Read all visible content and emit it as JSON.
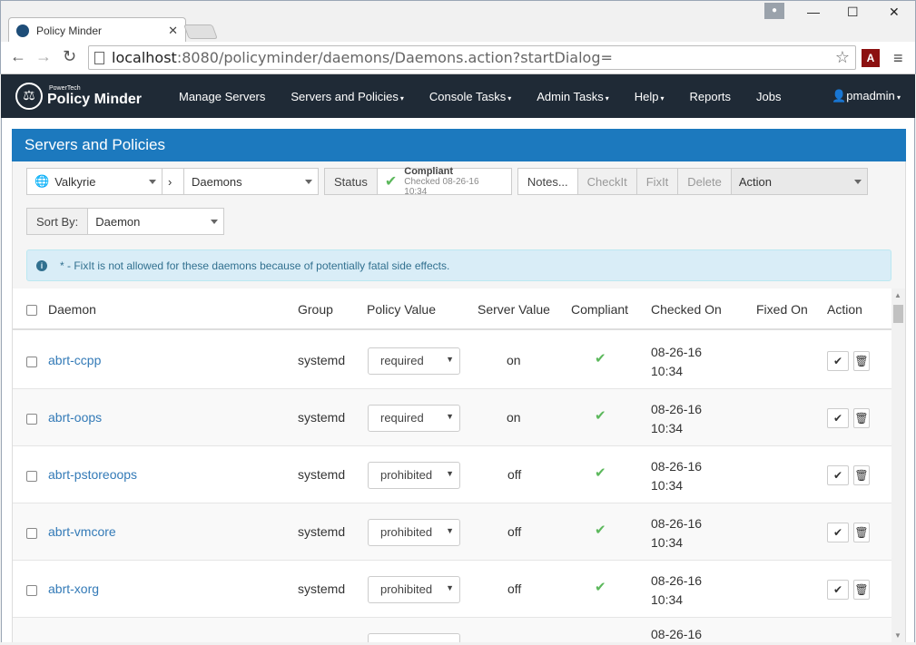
{
  "browser": {
    "tab_title": "Policy Minder",
    "tab_close": "✕",
    "url_host": "localhost",
    "url_path": ":8080/policyminder/daemons/Daemons.action?startDialog=",
    "pdf_label": "A",
    "win_minimize": "—",
    "win_maximize": "☐",
    "win_close": "✕"
  },
  "nav": {
    "brand_small": "PowerTech",
    "brand_big": "Policy Minder",
    "items": [
      {
        "label": "Manage Servers",
        "caret": ""
      },
      {
        "label": "Servers and Policies",
        "caret": "▾"
      },
      {
        "label": "Console Tasks",
        "caret": "▾"
      },
      {
        "label": "Admin Tasks",
        "caret": "▾"
      },
      {
        "label": "Help",
        "caret": "▾"
      },
      {
        "label": "Reports",
        "caret": ""
      },
      {
        "label": "Jobs",
        "caret": ""
      }
    ],
    "user": "pmadmin"
  },
  "panel": {
    "title": "Servers and Policies"
  },
  "toolbar": {
    "server": "Valkyrie",
    "policy": "Daemons",
    "status_label": "Status",
    "status_value": "Compliant",
    "status_checked": "Checked 08-26-16 10:34",
    "notes": "Notes...",
    "checkit": "CheckIt",
    "fixit": "FixIt",
    "delete": "Delete",
    "action": "Action",
    "sort_label": "Sort By:",
    "sort_value": "Daemon"
  },
  "alert": {
    "text": "* - FixIt is not allowed for these daemons because of potentially fatal side effects."
  },
  "table": {
    "headers": {
      "daemon": "Daemon",
      "group": "Group",
      "policy_value": "Policy Value",
      "server_value": "Server Value",
      "compliant": "Compliant",
      "checked_on": "Checked On",
      "fixed_on": "Fixed On",
      "action": "Action"
    },
    "rows": [
      {
        "daemon": "abrt-ccpp",
        "group": "systemd",
        "policy": "required",
        "server": "on",
        "date": "08-26-16",
        "time": "10:34"
      },
      {
        "daemon": "abrt-oops",
        "group": "systemd",
        "policy": "required",
        "server": "on",
        "date": "08-26-16",
        "time": "10:34"
      },
      {
        "daemon": "abrt-pstoreoops",
        "group": "systemd",
        "policy": "prohibited",
        "server": "off",
        "date": "08-26-16",
        "time": "10:34"
      },
      {
        "daemon": "abrt-vmcore",
        "group": "systemd",
        "policy": "prohibited",
        "server": "off",
        "date": "08-26-16",
        "time": "10:34"
      },
      {
        "daemon": "abrt-xorg",
        "group": "systemd",
        "policy": "prohibited",
        "server": "off",
        "date": "08-26-16",
        "time": "10:34"
      },
      {
        "daemon": "",
        "group": "",
        "policy": "",
        "server": "",
        "date": "08-26-16",
        "time": ""
      }
    ]
  },
  "colors": {
    "nav_bg": "#1f2a36",
    "panel_head": "#1c79be",
    "link": "#337ab7",
    "success": "#5cb85c",
    "alert_bg": "#d9edf7"
  }
}
